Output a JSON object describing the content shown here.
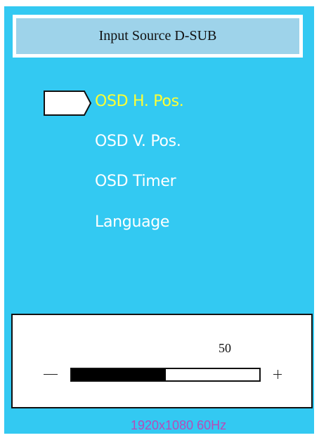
{
  "osd": {
    "title": "Input Source D-SUB",
    "menu": [
      {
        "label": "OSD H. Pos.",
        "selected": true
      },
      {
        "label": "OSD V. Pos.",
        "selected": false
      },
      {
        "label": "OSD Timer",
        "selected": false
      },
      {
        "label": "Language",
        "selected": false
      }
    ],
    "cursor_icon": "pentagon-arrow-icon",
    "value": "50",
    "slider_level_percent": 50,
    "minus_icon": "minus-icon",
    "plus_icon": "plus-icon",
    "resolution": "1920x1080 60Hz"
  },
  "colors": {
    "panel_background": "#33c9f2",
    "title_background": "#9ed3ea",
    "selected_text": "#ffff33",
    "menu_text": "#ffffff",
    "resolution_text": "#b74bb8"
  }
}
